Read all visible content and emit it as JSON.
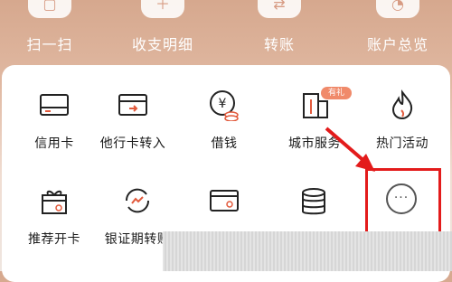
{
  "shortcuts": [
    {
      "label": "扫一扫",
      "icon": "scan-icon"
    },
    {
      "label": "收支明细",
      "icon": "ledger-icon"
    },
    {
      "label": "转账",
      "icon": "transfer-icon"
    },
    {
      "label": "账户总览",
      "icon": "account-overview-icon"
    }
  ],
  "grid": {
    "row1": [
      {
        "label": "信用卡",
        "icon": "credit-card-icon"
      },
      {
        "label": "他行卡转入",
        "icon": "card-transfer-in-icon"
      },
      {
        "label": "借钱",
        "icon": "loan-icon"
      },
      {
        "label": "城市服务",
        "icon": "city-service-icon",
        "badge": "有礼"
      },
      {
        "label": "热门活动",
        "icon": "flame-icon"
      }
    ],
    "row2": [
      {
        "label": "推荐开卡",
        "icon": "gift-icon"
      },
      {
        "label": "银证期转账",
        "icon": "securities-transfer-icon"
      },
      {
        "label": "",
        "icon": "card-settings-icon"
      },
      {
        "label": "",
        "icon": "coins-stack-icon"
      },
      {
        "label": "",
        "icon": "more-icon"
      }
    ]
  },
  "colors": {
    "accent": "#e31b1b",
    "badge": "#f08a6a"
  }
}
